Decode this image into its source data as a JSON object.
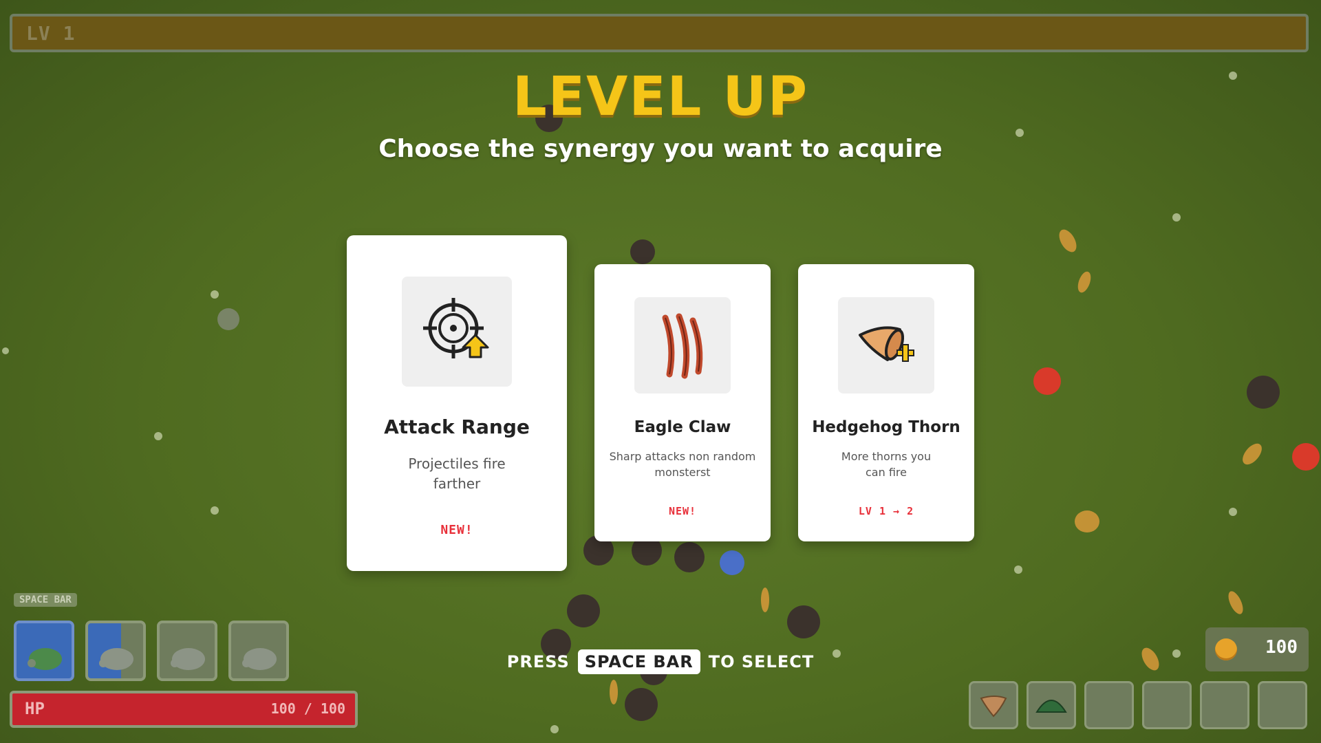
{
  "header": {
    "level_label": "LV 1",
    "title": "LEVEL UP",
    "subtitle": "Choose the synergy you want to acquire"
  },
  "cards": [
    {
      "title": "Attack Range",
      "description": "Projectiles fire farther",
      "badge": "NEW!",
      "icon": "crosshair-upgrade-icon"
    },
    {
      "title": "Eagle Claw",
      "description": "Sharp attacks non random monsterst",
      "badge": "NEW!",
      "icon": "claw-scratch-icon"
    },
    {
      "title": "Hedgehog Thorn",
      "description": "More thorns you can fire",
      "badge": "LV 1 → 2",
      "icon": "thorn-plus-icon"
    }
  ],
  "hint": {
    "press": "PRESS",
    "key": "SPACE BAR",
    "to_select": "TO SELECT"
  },
  "skills": {
    "tag": "SPACE BAR",
    "slots": [
      "turtle-icon",
      "turtle-icon",
      "turtle-icon",
      "turtle-icon"
    ]
  },
  "hp": {
    "label": "HP",
    "value": "100 / 100",
    "fraction": 1.0
  },
  "coins": {
    "value": "100"
  },
  "inventory": {
    "items": [
      "thorn-icon",
      "turtle-shell-icon",
      "",
      "",
      "",
      ""
    ]
  },
  "colors": {
    "title": "#f5c518",
    "badge": "#e8303a",
    "hp": "#c5242d",
    "slot_active": "#3b6ab8",
    "grass": "#4f6b20"
  }
}
